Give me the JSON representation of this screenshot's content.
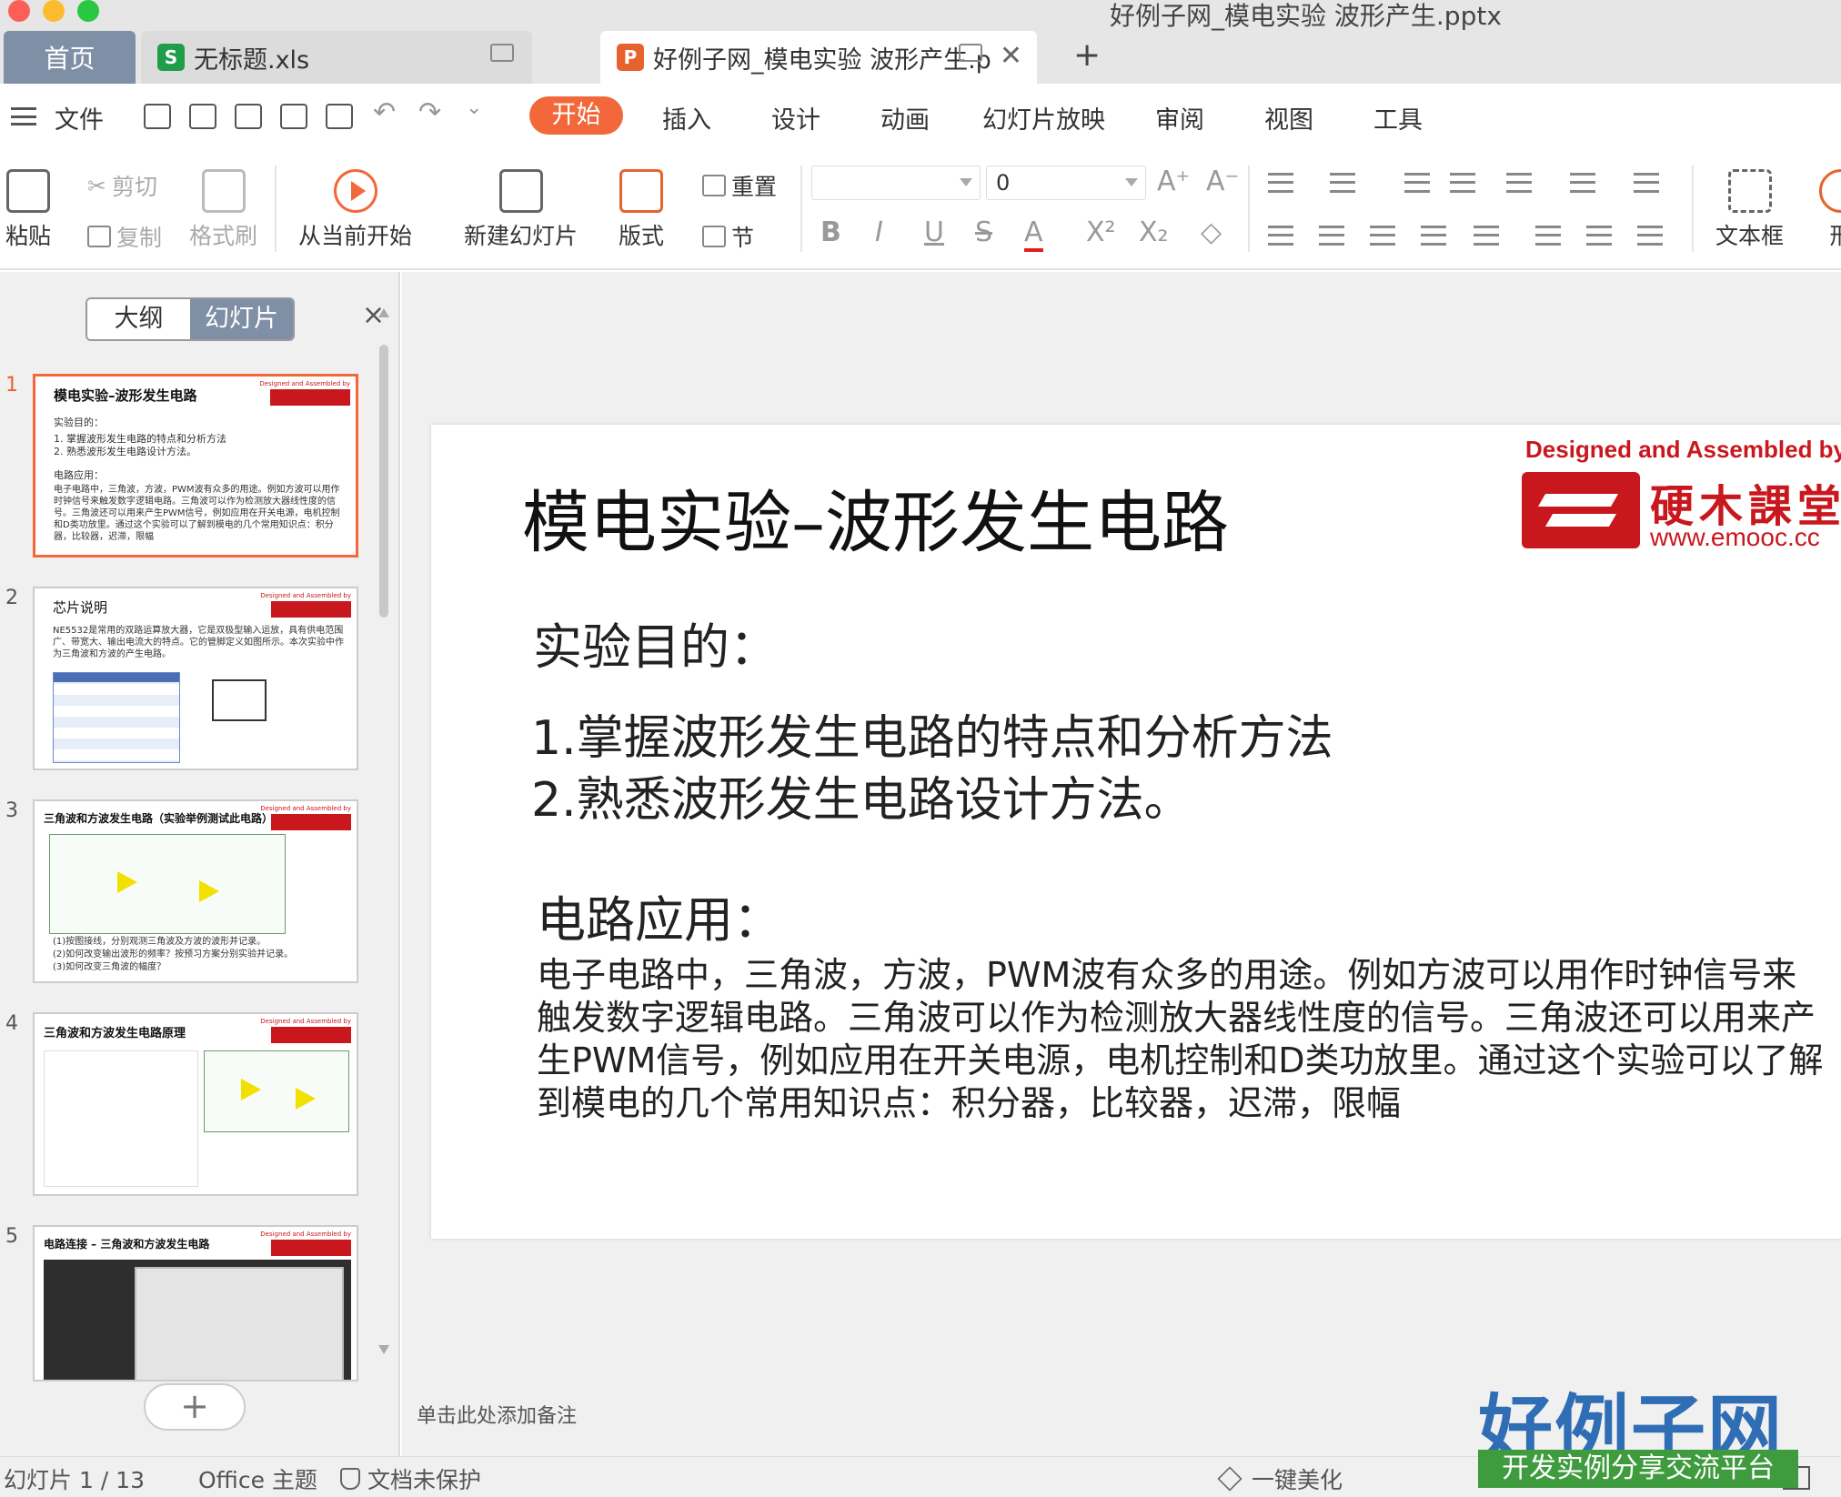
{
  "window": {
    "title": "好例子网_模电实验 波形产生.pptx"
  },
  "tabs": {
    "home": "首页",
    "xls": "无标题.xls",
    "ppt": "好例子网_模电实验 波形产生.p",
    "add": "+"
  },
  "menu": {
    "file": "文件",
    "tabs": [
      "开始",
      "插入",
      "设计",
      "动画",
      "幻灯片放映",
      "审阅",
      "视图",
      "工具"
    ]
  },
  "ribbon": {
    "paste": "粘贴",
    "cut": "剪切",
    "copy": "复制",
    "format_painter": "格式刷",
    "from_current": "从当前开始",
    "new_slide": "新建幻灯片",
    "layout": "版式",
    "reset": "重置",
    "section": "节",
    "font_size": "0",
    "textbox": "文本框",
    "shape_partial": "形"
  },
  "panel": {
    "tab_outline": "大纲",
    "tab_slides": "幻灯片",
    "close": "×",
    "add": "+"
  },
  "thumbnails": [
    {
      "num": "1",
      "title": "模电实验–波形发生电路",
      "lines": [
        "实验目的：",
        "1. 掌握波形发生电路的特点和分析方法",
        "2. 熟悉波形发生电路设计方法。",
        "电路应用："
      ],
      "para": "电子电路中，三角波，方波，PWM波有众多的用途。例如方波可以用作时钟信号来触发数字逻辑电路。三角波可以作为检测放大器线性度的信号。三角波还可以用来产生PWM信号，例如应用在开关电源，电机控制和D类功放里。通过这个实验可以了解到模电的几个常用知识点：积分器，比较器，迟滞，限幅"
    },
    {
      "num": "2",
      "title": "芯片说明",
      "para": "NE5532是常用的双路运算放大器，它是双极型输入运放，具有供电范围广、带宽大、输出电流大的特点。它的管脚定义如图所示。本次实验中作为三角波和方波的产生电路。"
    },
    {
      "num": "3",
      "title": "三角波和方波发生电路（实验举例测试此电路）",
      "lines": [
        "(1)按图接线，分别观测三角波及方波的波形并记录。",
        "(2)如何改变输出波形的频率？按预习方案分别实验并记录。",
        "(3)如何改变三角波的幅度？"
      ]
    },
    {
      "num": "4",
      "title": "三角波和方波发生电路原理"
    },
    {
      "num": "5",
      "title": "电路连接 – 三角波和方波发生电路"
    }
  ],
  "slide": {
    "title": "模电实验–波形发生电路",
    "logo": {
      "designed": "Designed and Assembled by",
      "name_cn": "硬木課堂",
      "url": "www.emooc.cc"
    },
    "objective_heading": "实验目的：",
    "objectives": [
      "1.掌握波形发生电路的特点和分析方法",
      "2.熟悉波形发生电路设计方法。"
    ],
    "application_heading": "电路应用：",
    "application_body": "电子电路中，三角波，方波，PWM波有众多的用途。例如方波可以用作时钟信号来触发数字逻辑电路。三角波可以作为检测放大器线性度的信号。三角波还可以用来产生PWM信号，例如应用在开关电源，电机控制和D类功放里。通过这个实验可以了解到模电的几个常用知识点：积分器，比较器，迟滞，限幅"
  },
  "notes": {
    "placeholder": "单击此处添加备注"
  },
  "status": {
    "slide_counter": "幻灯片 1 / 13",
    "theme": "Office 主题",
    "protection": "文档未保护",
    "beautify": "一键美化"
  },
  "watermark": {
    "main": "好例子网",
    "sub": "开发实例分享交流平台"
  },
  "colors": {
    "accent": "#f2683a",
    "logo_red": "#c9171e",
    "active_tab": "#7f8fa6"
  }
}
